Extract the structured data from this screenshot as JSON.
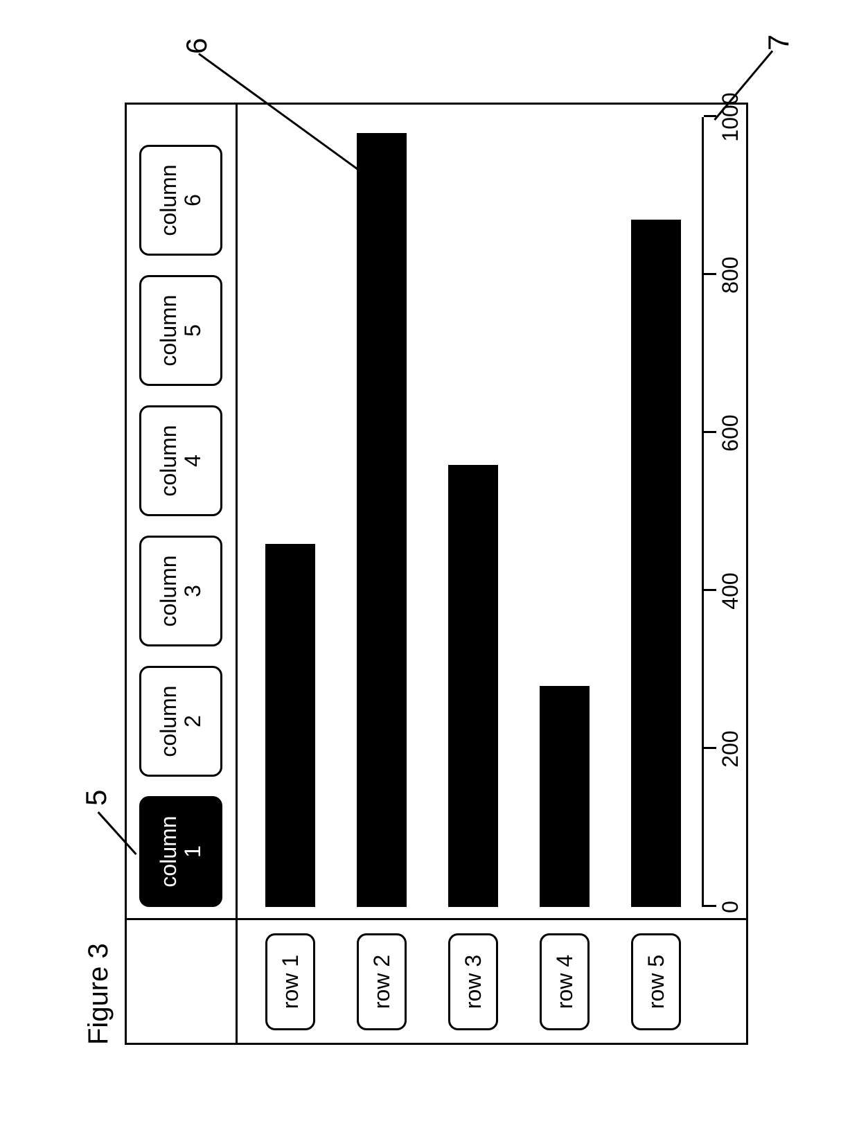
{
  "figure_title": "Figure 3",
  "column_buttons": [
    {
      "label_l1": "column",
      "label_l2": "1",
      "selected": true
    },
    {
      "label_l1": "column",
      "label_l2": "2",
      "selected": false
    },
    {
      "label_l1": "column",
      "label_l2": "3",
      "selected": false
    },
    {
      "label_l1": "column",
      "label_l2": "4",
      "selected": false
    },
    {
      "label_l1": "column",
      "label_l2": "5",
      "selected": false
    },
    {
      "label_l1": "column",
      "label_l2": "6",
      "selected": false
    }
  ],
  "row_buttons": [
    {
      "label": "row 1"
    },
    {
      "label": "row 2"
    },
    {
      "label": "row 3"
    },
    {
      "label": "row 4"
    },
    {
      "label": "row 5"
    }
  ],
  "axis_ticks": [
    "0",
    "200",
    "400",
    "600",
    "800",
    "1000"
  ],
  "callouts": {
    "c5": "5",
    "c6": "6",
    "c7": "7"
  },
  "chart_data": {
    "type": "bar",
    "orientation": "horizontal",
    "categories": [
      "row 1",
      "row 2",
      "row 3",
      "row 4",
      "row 5"
    ],
    "values": [
      460,
      980,
      560,
      280,
      870
    ],
    "xlabel": "",
    "ylabel": "",
    "xlim": [
      0,
      1000
    ]
  }
}
